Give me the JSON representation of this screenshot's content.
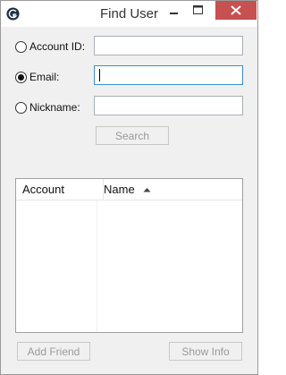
{
  "window": {
    "title": "Find User",
    "colors": {
      "close_button": "#c75050",
      "focus_border": "#3c8ed8"
    }
  },
  "search": {
    "options": [
      {
        "label": "Account ID:",
        "checked": false,
        "value": ""
      },
      {
        "label": "Email:",
        "checked": true,
        "value": ""
      },
      {
        "label": "Nickname:",
        "checked": false,
        "value": ""
      }
    ],
    "button_label": "Search"
  },
  "results": {
    "columns": [
      "Account",
      "Name"
    ],
    "sort_column": "Name",
    "sort_direction": "ascending",
    "rows": []
  },
  "footer": {
    "add_friend_label": "Add Friend",
    "show_info_label": "Show Info"
  }
}
